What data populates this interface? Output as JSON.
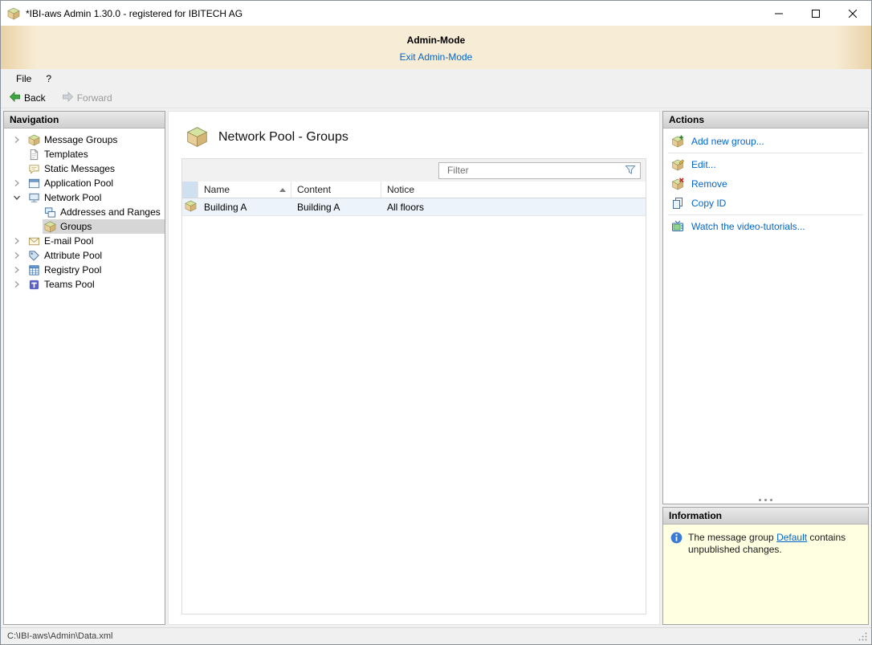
{
  "titlebar": {
    "title": "*IBI-aws Admin 1.30.0 - registered for IBITECH AG"
  },
  "banner": {
    "title": "Admin-Mode",
    "exit_link": "Exit Admin-Mode"
  },
  "menubar": {
    "file": "File",
    "help": "?"
  },
  "toolbar": {
    "back": "Back",
    "forward": "Forward"
  },
  "navigation": {
    "header": "Navigation",
    "items": [
      {
        "label": "Message Groups"
      },
      {
        "label": "Templates"
      },
      {
        "label": "Static Messages"
      },
      {
        "label": "Application Pool"
      },
      {
        "label": "Network Pool"
      },
      {
        "label": "Addresses and Ranges"
      },
      {
        "label": "Groups"
      },
      {
        "label": "E-mail Pool"
      },
      {
        "label": "Attribute Pool"
      },
      {
        "label": "Registry Pool"
      },
      {
        "label": "Teams Pool"
      }
    ]
  },
  "main": {
    "title": "Network Pool - Groups",
    "filter_placeholder": "Filter",
    "table": {
      "columns": [
        "Name",
        "Content",
        "Notice"
      ],
      "rows": [
        {
          "name": "Building A",
          "content": "Building A",
          "notice": "All floors"
        }
      ]
    }
  },
  "actions": {
    "header": "Actions",
    "items": [
      {
        "label": "Add new group..."
      },
      {
        "label": "Edit..."
      },
      {
        "label": "Remove"
      },
      {
        "label": "Copy ID"
      },
      {
        "label": "Watch the video-tutorials..."
      }
    ]
  },
  "information": {
    "header": "Information",
    "text_before": "The message group ",
    "link_label": "Default",
    "text_after": " contains unpublished changes."
  },
  "statusbar": {
    "path": "C:\\IBI-aws\\Admin\\Data.xml"
  },
  "colors": {
    "link": "#0066cc",
    "banner_bg": "#f7ecd6",
    "info_bg": "#ffffe1",
    "selected_bg": "#d6d6d6"
  }
}
